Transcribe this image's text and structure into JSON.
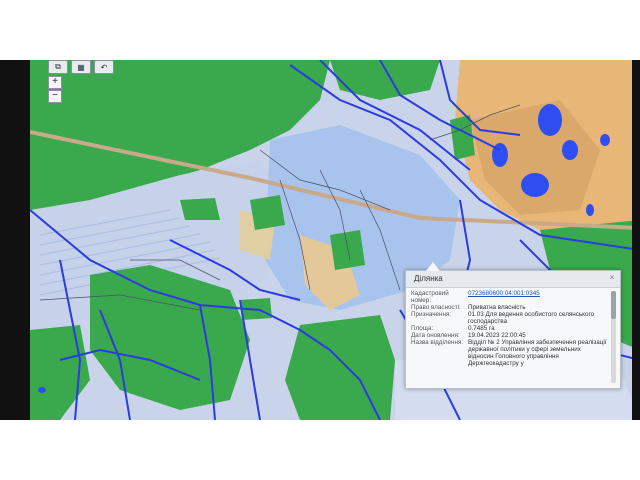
{
  "toolbar": {
    "buttons": [
      {
        "icon": "layers-icon",
        "glyph": "⧉"
      },
      {
        "icon": "grid-icon",
        "glyph": "▦"
      },
      {
        "icon": "undo-icon",
        "glyph": "↶"
      }
    ]
  },
  "zoom": {
    "in": "+",
    "out": "−"
  },
  "popup": {
    "title": "Ділянка",
    "close": "×",
    "rows": [
      {
        "label": "Кадастровий номер:",
        "value": "0723680600:04:001:0345",
        "link": true
      },
      {
        "label": "Право власності:",
        "value": "Приватна власність"
      },
      {
        "label": "Призначення:",
        "value": "01.03 Для ведення особистого селянського господарства"
      },
      {
        "label": "Площа:",
        "value": "0.7485 га"
      },
      {
        "label": "Дата оновлення:",
        "value": "19.04.2023 22:00:45"
      },
      {
        "label": "Назва відділення:",
        "value": "Відділ № 2 Управління забезпечення реалізації державної політики у сфері земельних відносин Головного управління Держгеокадастру у"
      }
    ]
  },
  "colors": {
    "forest": "#38a84a",
    "field": "#b7c8e8",
    "fieldLight": "#d8dff0",
    "orange": "#e8b070",
    "water": "#2a4cf0",
    "road": "#2b3ce0"
  }
}
